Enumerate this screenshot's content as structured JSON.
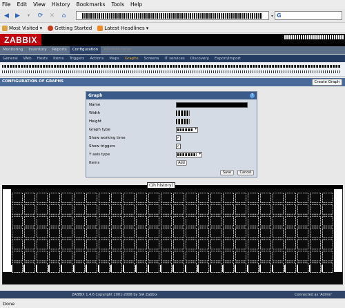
{
  "menubar": {
    "items": [
      "File",
      "Edit",
      "View",
      "History",
      "Bookmarks",
      "Tools",
      "Help"
    ]
  },
  "navbar": {
    "search_engine_letter": "G"
  },
  "bookmarks": {
    "items": [
      "Most Visited",
      "Getting Started",
      "Latest Headlines"
    ]
  },
  "app": {
    "logo": "ZABBIX",
    "main_menu": [
      "Monitoring",
      "Inventory",
      "Reports",
      "Configuration",
      "Administration"
    ],
    "main_menu_active": 3,
    "sub_menu": [
      "General",
      "Web",
      "Hosts",
      "Items",
      "Triggers",
      "Actions",
      "Maps",
      "Graphs",
      "Screens",
      "IT services",
      "Discovery",
      "Export/Import"
    ],
    "sub_menu_active": 7
  },
  "section": {
    "title": "CONFIGURATION OF GRAPHS",
    "create_button": "Create Graph"
  },
  "form": {
    "title": "Graph",
    "help_icon": "?",
    "rows": [
      {
        "label": "Name",
        "type": "dark"
      },
      {
        "label": "Width",
        "type": "noise"
      },
      {
        "label": "Height",
        "type": "noise"
      },
      {
        "label": "Graph type",
        "type": "select"
      },
      {
        "label": "Show working time",
        "type": "check"
      },
      {
        "label": "Show triggers",
        "type": "check"
      },
      {
        "label": "Y axis type",
        "type": "select"
      },
      {
        "label": "Items",
        "type": "button"
      }
    ],
    "add_button": "Add",
    "save_button": "Save",
    "cancel_button": "Cancel"
  },
  "graph": {
    "title": "(1h history)"
  },
  "footer": {
    "copyright": "ZABBIX 1.4.6 Copyright 2001-2008 by SIA Zabbix",
    "connected": "Connected as 'Admin'"
  },
  "status": {
    "text": "Done"
  },
  "colors": {
    "zabbix_red": "#c0000a",
    "menu_blue": "#5d6f86",
    "submenu_navy": "#233b60",
    "section_blue": "#4a6a99",
    "active_orange": "#f0b232"
  }
}
